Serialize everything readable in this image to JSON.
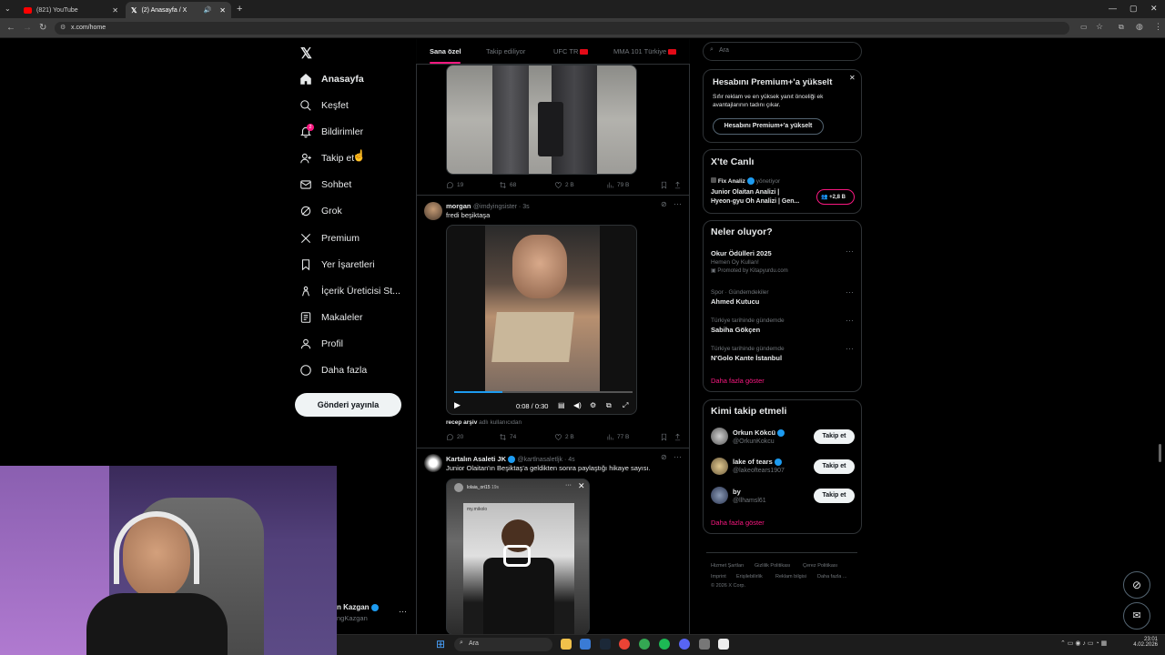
{
  "browser": {
    "tabs": [
      {
        "title": "(821) YouTube",
        "color": "#ff0000"
      },
      {
        "title": "(2) Anasayfa / X",
        "color": "#ffffff"
      }
    ],
    "url": "x.com/home"
  },
  "left_nav": {
    "items": [
      {
        "label": "Anasayfa",
        "icon": "home-icon"
      },
      {
        "label": "Keşfet",
        "icon": "search-icon"
      },
      {
        "label": "Bildirimler",
        "icon": "bell-icon",
        "badge": "2"
      },
      {
        "label": "Takip et",
        "icon": "follow-icon"
      },
      {
        "label": "Sohbet",
        "icon": "mail-icon"
      },
      {
        "label": "Grok",
        "icon": "grok-icon"
      },
      {
        "label": "Premium",
        "icon": "x-icon"
      },
      {
        "label": "Yer İşaretleri",
        "icon": "bookmark-icon"
      },
      {
        "label": "İçerik Üreticisi St...",
        "icon": "creator-icon"
      },
      {
        "label": "Makaleler",
        "icon": "article-icon"
      },
      {
        "label": "Profil",
        "icon": "user-icon"
      },
      {
        "label": "Daha fazla",
        "icon": "more-icon"
      }
    ],
    "post_button": "Gönderi yayınla",
    "account": {
      "name": "n Kazgan",
      "handle": "ngKazgan"
    }
  },
  "timeline": {
    "tabs": [
      "Sana özel",
      "Takip ediliyor",
      "UFC TR",
      "MMA 101 Türkiye"
    ],
    "posts": [
      {
        "stats": {
          "replies": "19",
          "reposts": "68",
          "likes": "2 B",
          "views": "79 B"
        }
      },
      {
        "name": "morgan",
        "handle": "@imdyingsister · 3s",
        "text": "fredi beşiktaşa",
        "video_time": "0:08 / 0:30",
        "caption": "recep arşiv",
        "caption_note": "adlı kullanıcıdan",
        "stats": {
          "replies": "20",
          "reposts": "74",
          "likes": "2 B",
          "views": "77 B"
        }
      },
      {
        "name": "Kartalın Asaleti JK",
        "handle": "@kartlnasaletljk · 4s",
        "text": "Junior Olaitan'ın Beşiktaş'a geldikten sonra paylaştığı hikaye sayısı.",
        "story_user": "lolaia_ori15",
        "story_age": "19s",
        "story_sub": "my.mikolo"
      }
    ]
  },
  "right": {
    "search_placeholder": "Ara",
    "premium": {
      "title": "Hesabını Premium+'a yükselt",
      "desc": "Sıfır reklam ve en yüksek yanıt önceliği ek avantajlarının tadını çıkar.",
      "button": "Hesabını Premium+'a yükselt"
    },
    "live": {
      "title": "X'te Canlı",
      "host": "Fix Analiz",
      "host_role": "yönetiyor",
      "line1": "Junior Olaitan Analizi |",
      "line2": "Hyeon-gyu Oh Analizi | Gen...",
      "count": "+2,8 B"
    },
    "trends": {
      "title": "Neler oluyor?",
      "items": [
        {
          "meta": "",
          "name": "Okur Ödülleri 2025",
          "sub": "Hemen Oy Kullan!",
          "promo": "Promoted by Kitapyurdu.com"
        },
        {
          "meta": "Spor · Gündemdekiler",
          "name": "Ahmed Kutucu",
          "sub": "",
          "promo": ""
        },
        {
          "meta": "Türkiye tarihinde gündemde",
          "name": "Sabiha Gökçen",
          "sub": "",
          "promo": ""
        },
        {
          "meta": "Türkiye tarihinde gündemde",
          "name": "N'Golo Kante İstanbul",
          "sub": "",
          "promo": ""
        }
      ],
      "more": "Daha fazla göster"
    },
    "who_to_follow": {
      "title": "Kimi takip etmeli",
      "items": [
        {
          "name": "Orkun Kökcü",
          "handle": "@OrkunKokcu",
          "button": "Takip et"
        },
        {
          "name": "lake of tears",
          "handle": "@lakeoftears1907",
          "button": "Takip et"
        },
        {
          "name": "by",
          "handle": "@llhamsl61",
          "button": "Takip et"
        }
      ],
      "more": "Daha fazla göster"
    },
    "footer": {
      "row1": [
        "Hizmet Şartları",
        "Gizlilik Politikası",
        "Çerez Politikası"
      ],
      "row2": [
        "Imprint",
        "Erişilebilirlik",
        "Reklam bilgisi",
        "Daha fazla ..."
      ],
      "copyright": "© 2026 X Corp."
    }
  },
  "taskbar": {
    "search": "Ara",
    "time": "23:01",
    "date": "4.02.2026"
  }
}
